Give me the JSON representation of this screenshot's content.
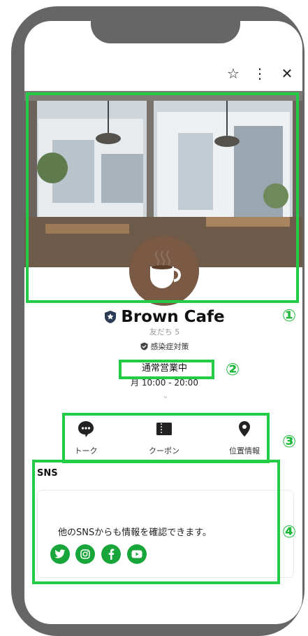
{
  "header": {
    "star_icon": "star-outline-icon",
    "menu_icon": "more-vertical-icon",
    "close_icon": "close-icon",
    "star_glyph": "☆",
    "menu_glyph": "⋮",
    "close_glyph": "✕"
  },
  "profile": {
    "name": "Brown Cafe",
    "friends": "友だち 5",
    "covid_badge": "感染症対策",
    "status": "通常営業中",
    "hours": "月 10:00 - 20:00",
    "expand_glyph": "⌄"
  },
  "actions": [
    {
      "label": "トーク",
      "icon": "chat-bubble-icon"
    },
    {
      "label": "クーポン",
      "icon": "coupon-icon"
    },
    {
      "label": "位置情報",
      "icon": "location-pin-icon"
    }
  ],
  "sns": {
    "title": "SNS",
    "description": "他のSNSからも情報を確認できます。",
    "icons": [
      "twitter-icon",
      "instagram-icon",
      "facebook-icon",
      "youtube-icon"
    ]
  },
  "annotations": [
    "①",
    "②",
    "③",
    "④"
  ],
  "colors": {
    "frame": "#666666",
    "highlight_green": "#22cc44",
    "sns_green": "#18a63b",
    "logo_brown": "#7a5a45"
  }
}
